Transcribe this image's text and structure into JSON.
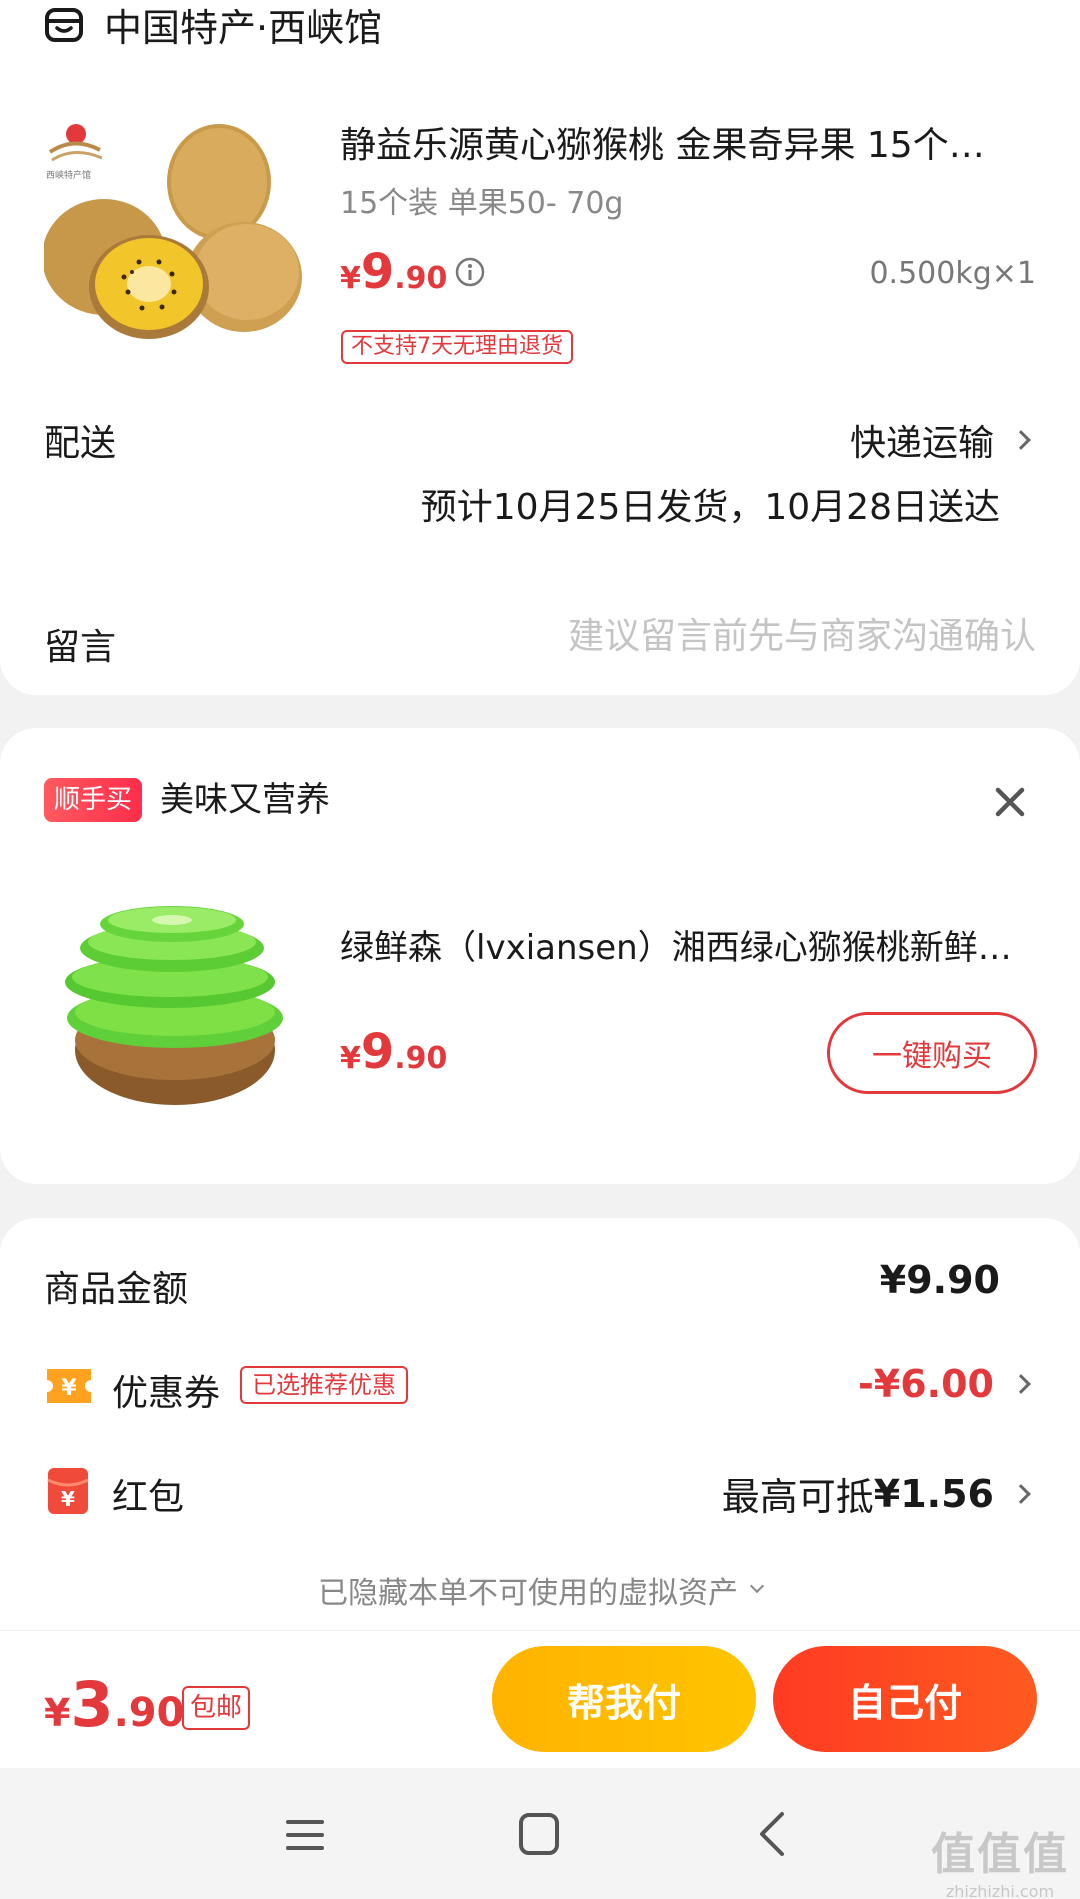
{
  "shop": {
    "name": "中国特产·西峡馆",
    "icon": "store-icon"
  },
  "product": {
    "title": "静益乐源黄心猕猴桃 金果奇异果 15个…",
    "spec": "15个装 单果50- 70g",
    "price": {
      "symbol": "¥",
      "int": "9",
      "dec": ".90"
    },
    "quantity": "0.500kg×1",
    "tag": "不支持7天无理由退货",
    "image_logo_text": "西峡特产馆"
  },
  "delivery": {
    "label": "配送",
    "method": "快递运输",
    "eta": "预计10月25日发货，10月28日送达"
  },
  "message": {
    "label": "留言",
    "placeholder": "建议留言前先与商家沟通确认"
  },
  "recommend": {
    "badge": "顺手买",
    "title": "美味又营养",
    "product_name": "绿鲜森（lvxiansen）湘西绿心猕猴桃新鲜…",
    "price": {
      "symbol": "¥",
      "int": "9",
      "dec": ".90"
    },
    "buy_label": "一键购买"
  },
  "summary": {
    "goods_label": "商品金额",
    "goods_value": "¥9.90",
    "coupon_label": "优惠券",
    "coupon_tag": "已选推荐优惠",
    "coupon_value": "-¥6.00",
    "coupon_icon_char": "¥",
    "hongbao_label": "红包",
    "hongbao_prefix": "最高可抵",
    "hongbao_amount": "¥1.56",
    "hongbao_icon_char": "¥",
    "hidden_note": "已隐藏本单不可使用的虚拟资产"
  },
  "footer": {
    "total": {
      "symbol": "¥",
      "int": "3",
      "dec": ".90"
    },
    "shipping": "包邮",
    "help_pay": "帮我付",
    "self_pay": "自己付"
  },
  "watermark": {
    "big": "值值值",
    "small": "zhizhizhi.com"
  },
  "colors": {
    "accent_red": "#e4393c",
    "help_btn": "#ffb300",
    "self_btn": "#ff3b22"
  }
}
